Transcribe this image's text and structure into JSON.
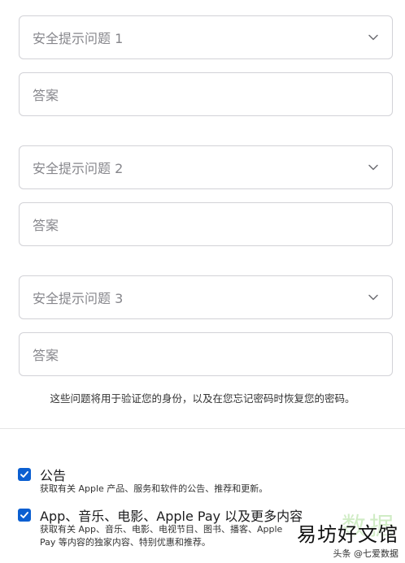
{
  "form": {
    "question1": {
      "placeholder": "安全提示问题 1",
      "icon": "chevron-down-icon"
    },
    "answer1": {
      "placeholder": "答案"
    },
    "question2": {
      "placeholder": "安全提示问题 2",
      "icon": "chevron-down-icon"
    },
    "answer2": {
      "placeholder": "答案"
    },
    "question3": {
      "placeholder": "安全提示问题 3",
      "icon": "chevron-down-icon"
    },
    "answer3": {
      "placeholder": "答案"
    },
    "hint": "这些问题将用于验证您的身份，以及在您忘记密码时恢复您的密码。"
  },
  "subscriptions": {
    "announcements": {
      "checked": true,
      "title": "公告",
      "desc": "获取有关 Apple 产品、服务和软件的公告、推荐和更新。"
    },
    "media": {
      "checked": true,
      "title": "App、音乐、电影、Apple Pay 以及更多内容",
      "desc": "获取有关 App、音乐、电影、电视节目、图书、播客、Apple Pay 等内容的独家内容、特别优惠和推荐。"
    }
  },
  "watermark": {
    "big": "易坊好文馆",
    "small": "头条 @七爱数据",
    "ghost": "数据"
  },
  "colors": {
    "border": "#d2d2d7",
    "placeholder": "#86868b",
    "checkbox": "#0b5fd1"
  }
}
